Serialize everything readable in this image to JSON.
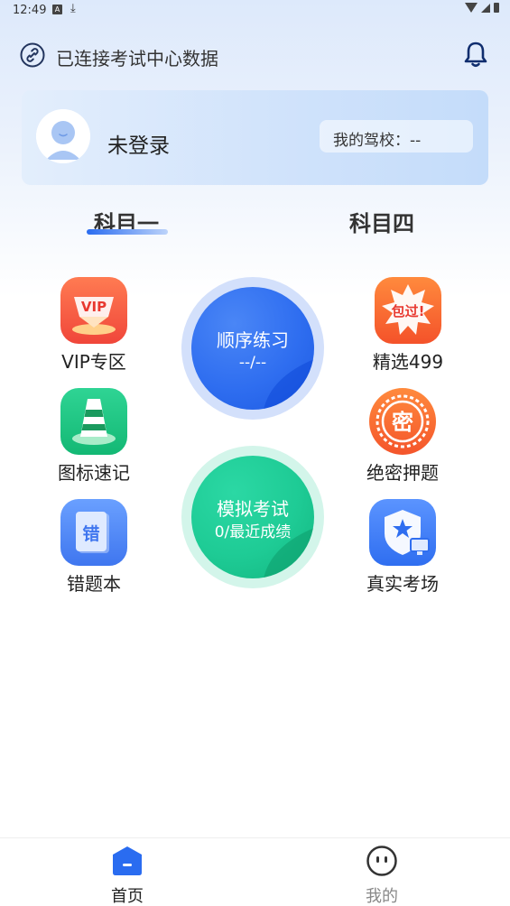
{
  "status_bar": {
    "time": "12:49",
    "notification_letter": "A"
  },
  "header": {
    "connection_text": "已连接考试中心数据"
  },
  "user_card": {
    "name": "未登录",
    "school_label": "我的驾校：--"
  },
  "subject_tabs": [
    {
      "label": "科目一",
      "selected": true
    },
    {
      "label": "科目四",
      "selected": false
    }
  ],
  "features_left": [
    {
      "label": "VIP专区",
      "icon": "vip-icon",
      "badge": "VIP"
    },
    {
      "label": "图标速记",
      "icon": "traffic-cone-icon"
    },
    {
      "label": "错题本",
      "icon": "wrong-book-icon",
      "badge": "错"
    }
  ],
  "features_right": [
    {
      "label": "精选499",
      "icon": "guaranteed-pass-icon",
      "badge": "包过!"
    },
    {
      "label": "绝密押题",
      "icon": "secret-stamp-icon",
      "badge": "密"
    },
    {
      "label": "真实考场",
      "icon": "exam-hall-icon"
    }
  ],
  "practice_circle": {
    "title": "顺序练习",
    "progress": "--/--"
  },
  "exam_circle": {
    "title": "模拟考试",
    "score": "0/最近成绩"
  },
  "bottom_nav": [
    {
      "label": "首页",
      "icon": "home-icon",
      "active": true
    },
    {
      "label": "我的",
      "icon": "profile-face-icon",
      "active": false
    }
  ],
  "colors": {
    "accent_blue": "#2a6cf0",
    "practice_blue": "#2f6ef0",
    "exam_green": "#1ecb95",
    "inactive_text": "#888888"
  }
}
